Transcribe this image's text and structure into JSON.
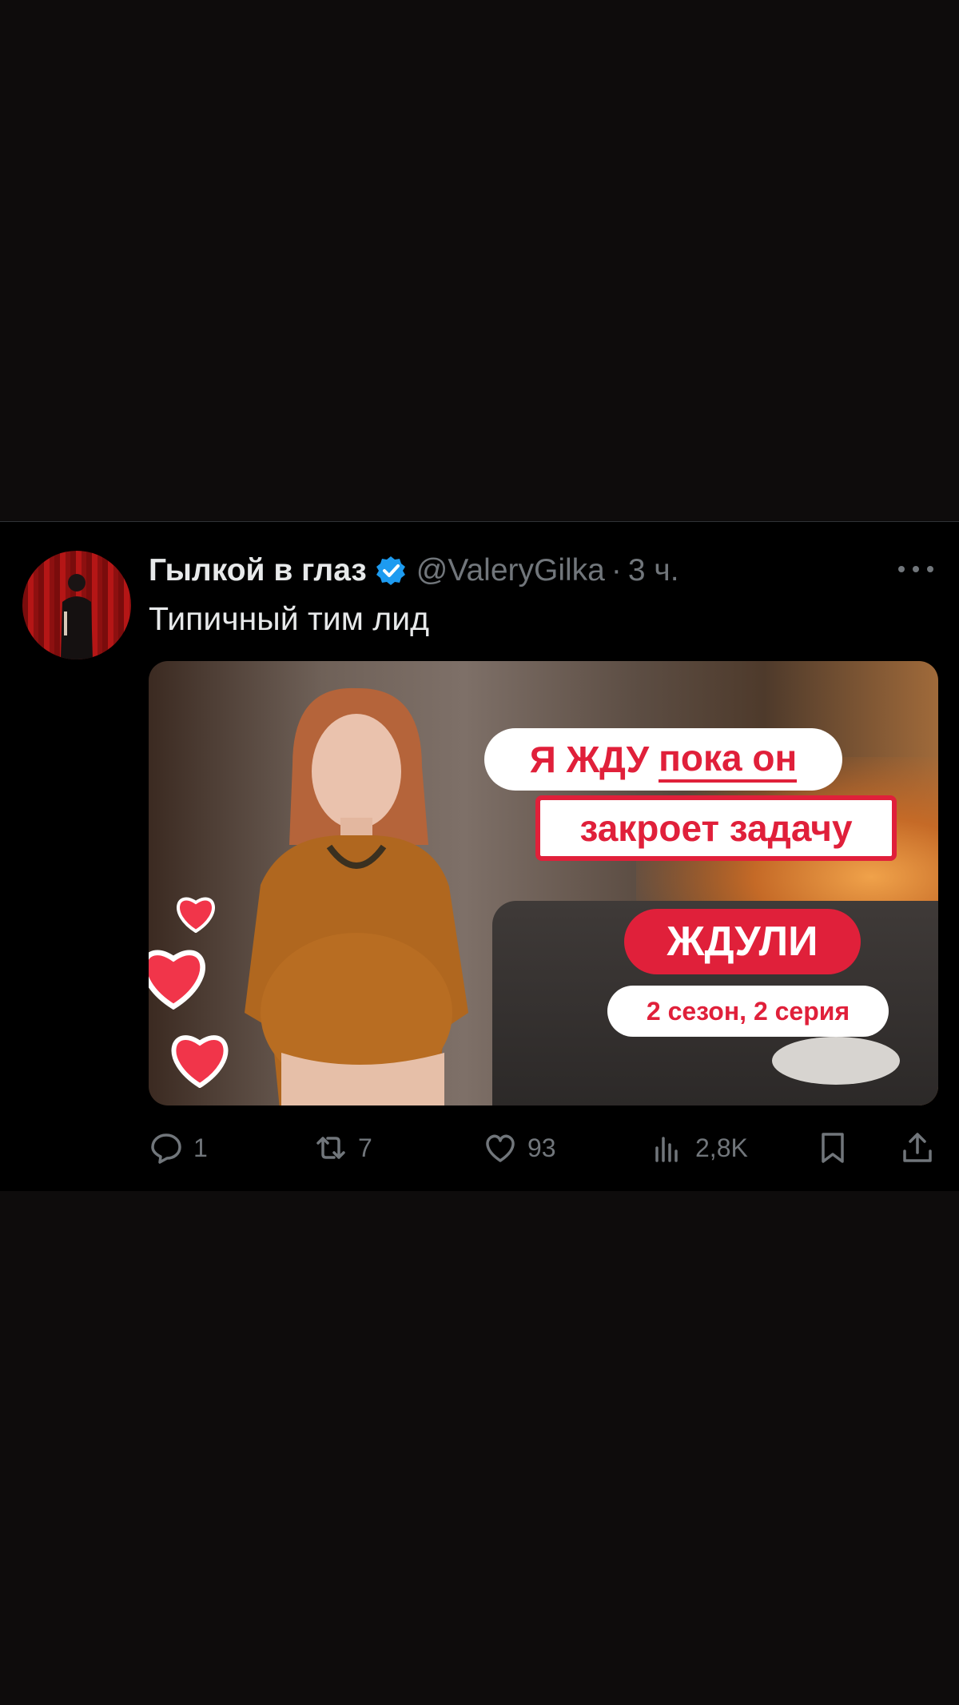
{
  "tweet": {
    "author_name": "Гылкой в глаз",
    "handle": "@ValeryGilka",
    "separator": "·",
    "time": "3 ч.",
    "text": "Типичный тим лид",
    "verified_color": "#1d9bf0"
  },
  "media": {
    "line1_part1": "Я ЖДУ",
    "line1_part2": "пока он",
    "line2": "закроет задачу",
    "show_title": "ЖДУЛИ",
    "episode": "2 сезон, 2 серия",
    "accent_color": "#e0203a"
  },
  "actions": {
    "replies": "1",
    "reposts": "7",
    "likes": "93",
    "views": "2,8K"
  },
  "icons": {
    "reply": "reply-icon",
    "repost": "repost-icon",
    "like": "heart-icon",
    "views": "views-icon",
    "bookmark": "bookmark-icon",
    "share": "share-icon",
    "more": "more-icon"
  }
}
